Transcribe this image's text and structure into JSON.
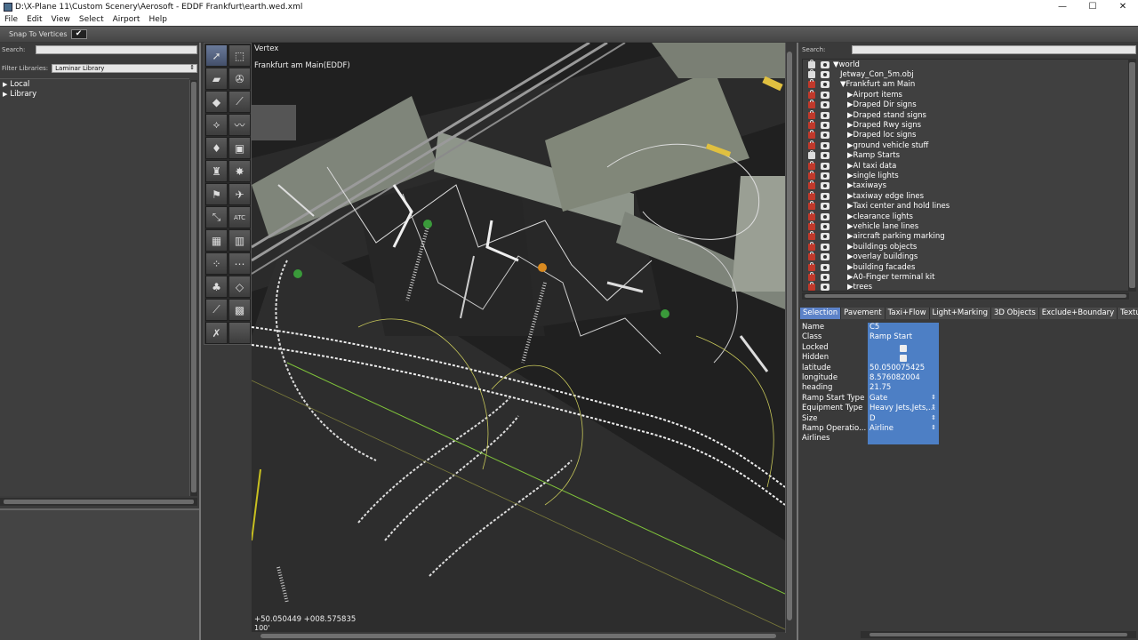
{
  "window": {
    "title": "D:\\X-Plane 11\\Custom Scenery\\Aerosoft - EDDF Frankfurt\\earth.wed.xml",
    "controls": {
      "minimize": "—",
      "maximize": "☐",
      "close": "✕"
    }
  },
  "menu": [
    "File",
    "Edit",
    "View",
    "Select",
    "Airport",
    "Help"
  ],
  "snap_bar": {
    "label": "Snap To Vertices",
    "checked": "✔"
  },
  "library_panel": {
    "search_label": "Search:",
    "filter_label": "Filter Libraries:",
    "filter_value": "Laminar Library",
    "items": [
      {
        "label": "Local",
        "arrow": "▶"
      },
      {
        "label": "Library",
        "arrow": "▶"
      }
    ]
  },
  "tools": [
    {
      "name": "vertex-tool",
      "glyph": "➚"
    },
    {
      "name": "marquee-tool",
      "glyph": "⬚"
    },
    {
      "name": "runway-tool",
      "glyph": "▰"
    },
    {
      "name": "helipad-tool",
      "glyph": "✇"
    },
    {
      "name": "taxiway-tool",
      "glyph": "◆"
    },
    {
      "name": "sealane-tool",
      "glyph": "⟋"
    },
    {
      "name": "boundary-tool",
      "glyph": "⟡"
    },
    {
      "name": "lines-tool",
      "glyph": "〰"
    },
    {
      "name": "light-tool",
      "glyph": "♦"
    },
    {
      "name": "sign-tool",
      "glyph": "▣"
    },
    {
      "name": "tower-tool",
      "glyph": "♜"
    },
    {
      "name": "beacon-tool",
      "glyph": "✸"
    },
    {
      "name": "windsock-tool",
      "glyph": "⚑"
    },
    {
      "name": "ramp-start-tool",
      "glyph": "✈"
    },
    {
      "name": "taxi-route-tool",
      "glyph": "⤡"
    },
    {
      "name": "atc-tool",
      "glyph": "ATC"
    },
    {
      "name": "object-tool",
      "glyph": "▦"
    },
    {
      "name": "facade-tool",
      "glyph": "▥"
    },
    {
      "name": "string-tool",
      "glyph": "⁘"
    },
    {
      "name": "obj-line-tool",
      "glyph": "⋯"
    },
    {
      "name": "forest-tool",
      "glyph": "♣"
    },
    {
      "name": "polygon-tool",
      "glyph": "◇"
    },
    {
      "name": "line-tool",
      "glyph": "⟋"
    },
    {
      "name": "draped-tool",
      "glyph": "▩"
    },
    {
      "name": "exclusion-tool",
      "glyph": "✗"
    },
    {
      "name": "blank-tool",
      "glyph": ""
    },
    {
      "name": "truck-tool",
      "glyph": "▭"
    },
    {
      "name": "route-tool",
      "glyph": "⊶"
    }
  ],
  "map": {
    "mode_label": "Vertex",
    "airport_label": "Frankfurt am Main(EDDF)",
    "coordinates": "+50.050449 +008.575835",
    "zoom": "100'"
  },
  "hierarchy_panel": {
    "search_label": "Search:",
    "rows": [
      {
        "label": "world",
        "prefix": "▼ ",
        "locked": false,
        "indent": 0
      },
      {
        "label": "Jetway_Con_5m.obj",
        "prefix": "",
        "locked": false,
        "indent": 1
      },
      {
        "label": "Frankfurt am Main",
        "prefix": "▼ ",
        "locked": true,
        "indent": 1
      },
      {
        "label": "Airport items",
        "prefix": "▶ ",
        "locked": true,
        "indent": 2
      },
      {
        "label": "Draped Dir signs",
        "prefix": "▶ ",
        "locked": true,
        "indent": 2
      },
      {
        "label": "Draped stand signs",
        "prefix": "▶ ",
        "locked": true,
        "indent": 2
      },
      {
        "label": "Draped Rwy signs",
        "prefix": "▶ ",
        "locked": true,
        "indent": 2
      },
      {
        "label": "Draped loc signs",
        "prefix": "▶ ",
        "locked": true,
        "indent": 2
      },
      {
        "label": "ground vehicle stuff",
        "prefix": "▶ ",
        "locked": true,
        "indent": 2
      },
      {
        "label": "Ramp Starts",
        "prefix": "▶ ",
        "locked": false,
        "indent": 2
      },
      {
        "label": "AI taxi data",
        "prefix": "▶ ",
        "locked": true,
        "indent": 2
      },
      {
        "label": "single lights",
        "prefix": "▶ ",
        "locked": true,
        "indent": 2
      },
      {
        "label": "taxiways",
        "prefix": "▶ ",
        "locked": true,
        "indent": 2
      },
      {
        "label": "taxiway edge lines",
        "prefix": "▶ ",
        "locked": true,
        "indent": 2
      },
      {
        "label": "Taxi center and hold lines",
        "prefix": "▶ ",
        "locked": true,
        "indent": 2
      },
      {
        "label": "clearance lights",
        "prefix": "▶ ",
        "locked": true,
        "indent": 2
      },
      {
        "label": "vehicle lane lines",
        "prefix": "▶ ",
        "locked": true,
        "indent": 2
      },
      {
        "label": "aircraft parking marking",
        "prefix": "▶ ",
        "locked": true,
        "indent": 2
      },
      {
        "label": "buildings objects",
        "prefix": "▶ ",
        "locked": true,
        "indent": 2
      },
      {
        "label": "overlay buildings",
        "prefix": "▶ ",
        "locked": true,
        "indent": 2
      },
      {
        "label": "building facades",
        "prefix": "▶ ",
        "locked": true,
        "indent": 2
      },
      {
        "label": "A0-Finger terminal kit",
        "prefix": "▶ ",
        "locked": true,
        "indent": 2
      },
      {
        "label": "trees",
        "prefix": "▶ ",
        "locked": true,
        "indent": 2
      }
    ]
  },
  "tabs": [
    {
      "label": "Selection",
      "active": true
    },
    {
      "label": "Pavement",
      "active": false
    },
    {
      "label": "Taxi+Flow",
      "active": false
    },
    {
      "label": "Light+Marking",
      "active": false
    },
    {
      "label": "3D Objects",
      "active": false
    },
    {
      "label": "Exclude+Boundary",
      "active": false
    },
    {
      "label": "Texture",
      "active": false
    }
  ],
  "properties": [
    {
      "key": "Name",
      "value": "C5",
      "kind": "text"
    },
    {
      "key": "Class",
      "value": "Ramp Start",
      "kind": "text"
    },
    {
      "key": "Locked",
      "value": "",
      "kind": "icon"
    },
    {
      "key": "Hidden",
      "value": "",
      "kind": "icon"
    },
    {
      "key": "latitude",
      "value": "50.050075425",
      "kind": "text"
    },
    {
      "key": "longitude",
      "value": "8.576082004",
      "kind": "text"
    },
    {
      "key": "heading",
      "value": "21.75",
      "kind": "text"
    },
    {
      "key": "Ramp Start Type",
      "value": "Gate",
      "kind": "enum"
    },
    {
      "key": "Equipment Type",
      "value": "Heavy Jets,Jets,...",
      "kind": "enum"
    },
    {
      "key": "Size",
      "value": "D",
      "kind": "enum"
    },
    {
      "key": "Ramp Operatio...",
      "value": "Airline",
      "kind": "enum"
    },
    {
      "key": "Airlines",
      "value": "",
      "kind": "text"
    }
  ],
  "colors": {
    "accent": "#4d7fc5",
    "lock_red": "#c0392b",
    "taxi_line_green": "#7fc23a"
  }
}
